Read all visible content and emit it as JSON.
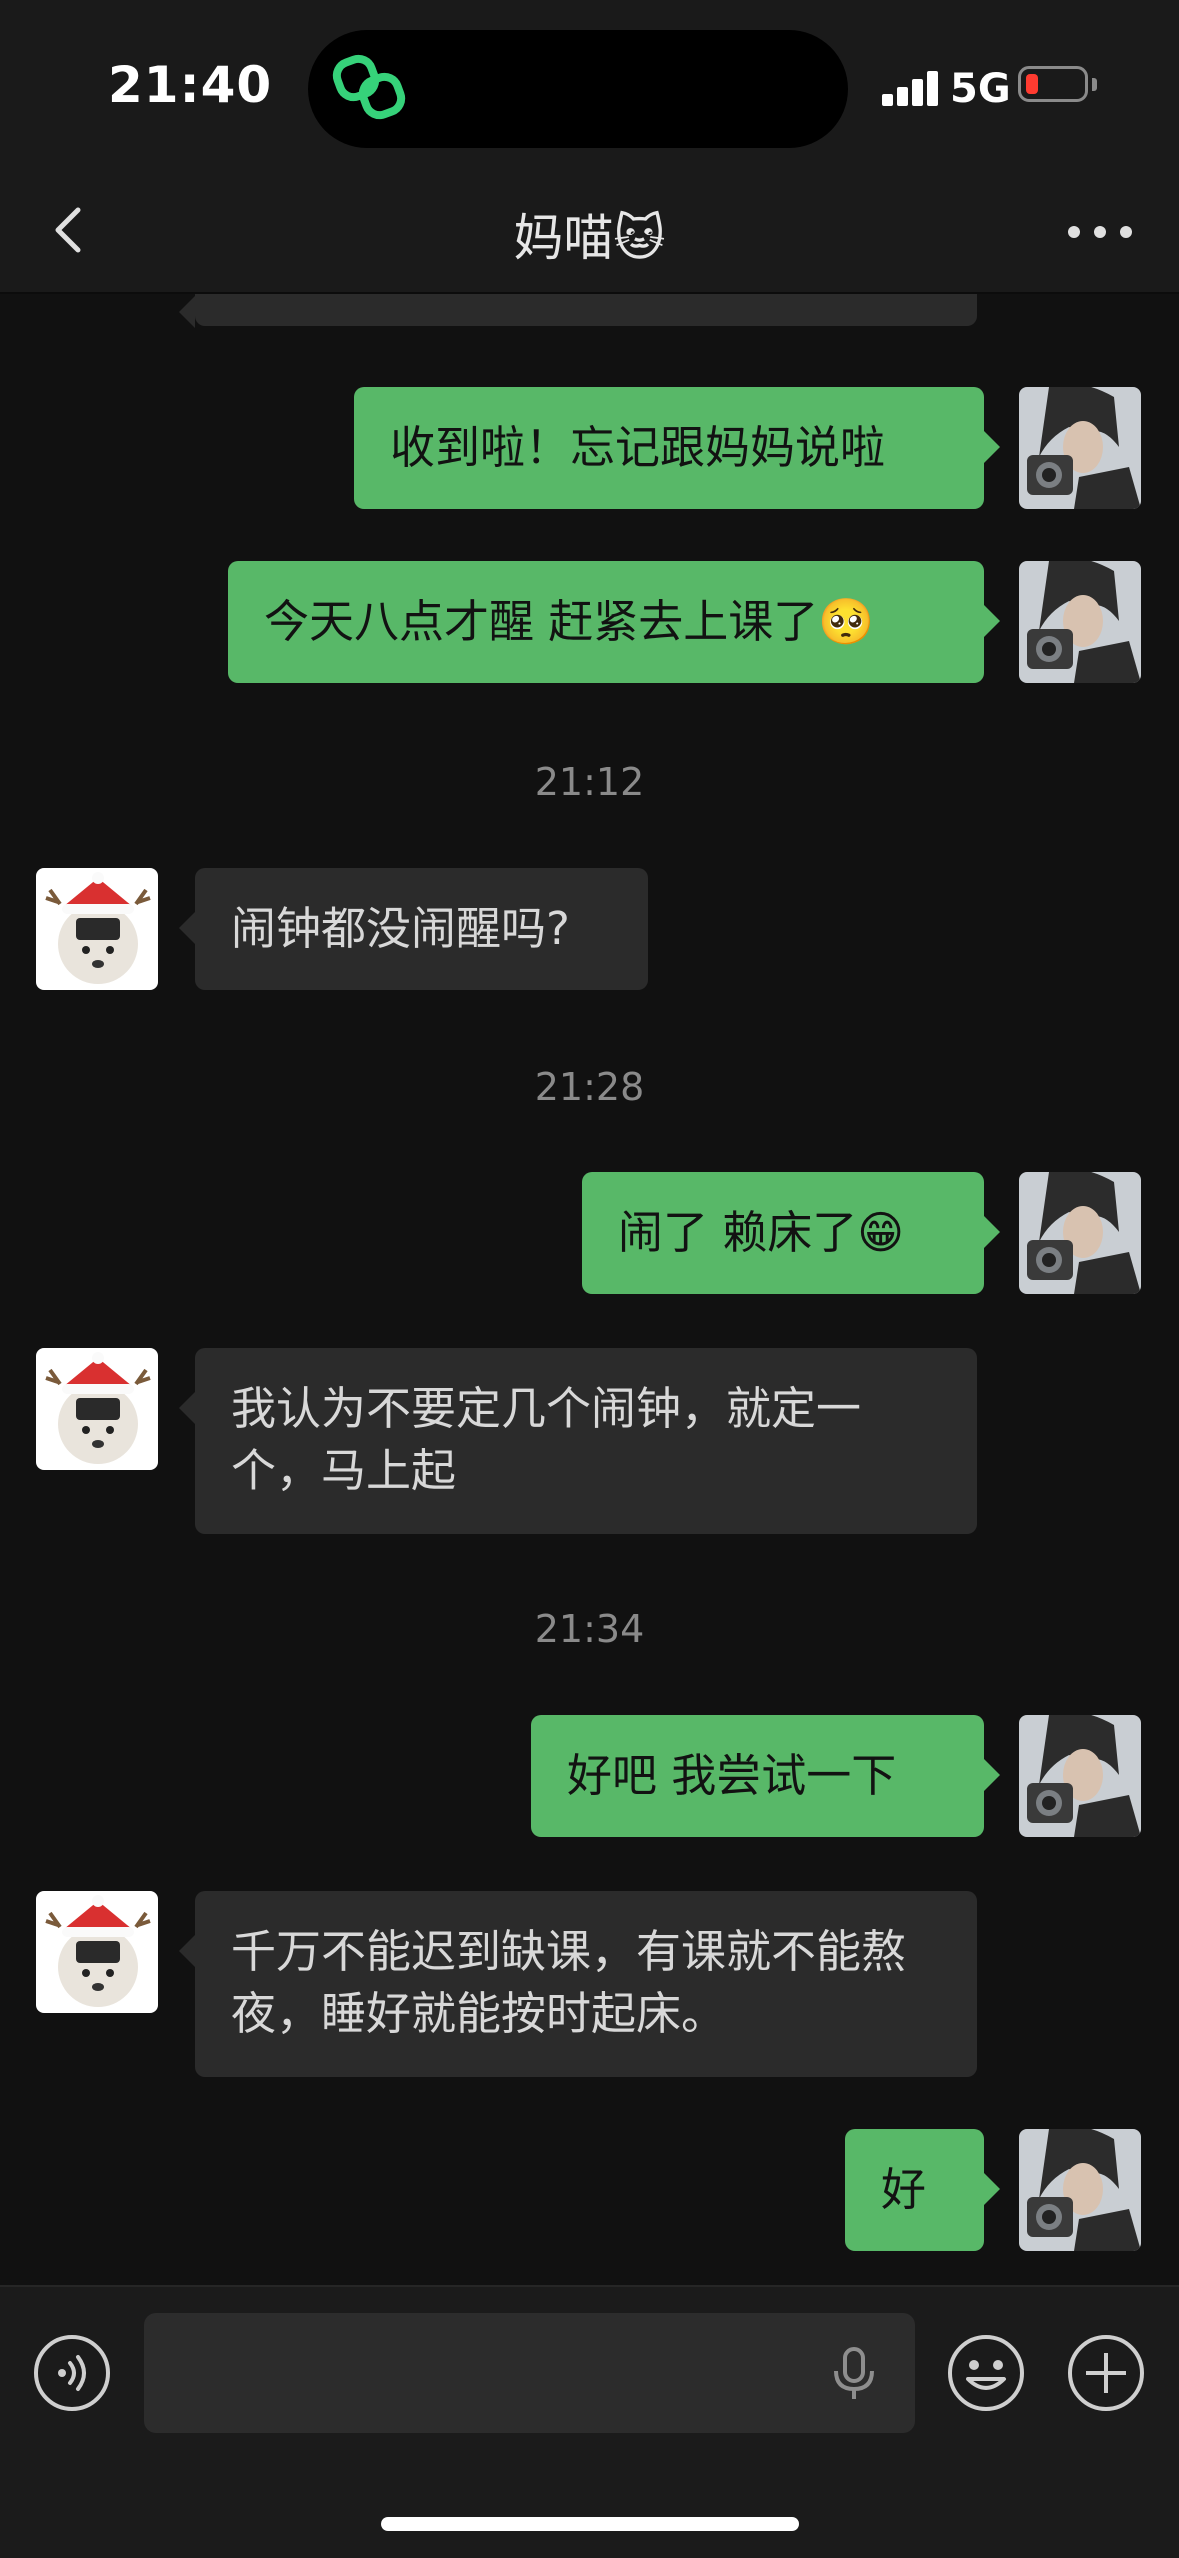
{
  "status_bar": {
    "time": "21:40",
    "network": "5G",
    "battery_level": 0.12,
    "battery_color": "#ff3b30"
  },
  "header": {
    "title": "妈喵🐱",
    "back_icon": "chevron-left-icon",
    "more_icon": "more-dots-icon"
  },
  "colors": {
    "outgoing_bubble": "#58b868",
    "incoming_bubble": "#2b2b2b",
    "background": "#111111"
  },
  "messages": [
    {
      "side": "in",
      "text": ""
    },
    {
      "side": "out",
      "text": "收到啦！忘记跟妈妈说啦"
    },
    {
      "side": "out",
      "text": "今天八点才醒 赶紧去上课了🥺"
    },
    {
      "type": "time",
      "text": "21:12"
    },
    {
      "side": "in",
      "text": "闹钟都没闹醒吗?"
    },
    {
      "type": "time",
      "text": "21:28"
    },
    {
      "side": "out",
      "text": "闹了 赖床了😁"
    },
    {
      "side": "in",
      "text": "我认为不要定几个闹钟，就定一个，马上起"
    },
    {
      "type": "time",
      "text": "21:34"
    },
    {
      "side": "out",
      "text": "好吧 我尝试一下"
    },
    {
      "side": "in",
      "text": "千万不能迟到缺课，有课就不能熬夜，睡好就能按时起床。"
    },
    {
      "side": "out",
      "text": "好"
    }
  ],
  "input_bar": {
    "voice_icon": "voice-mode-icon",
    "mic_icon": "microphone-icon",
    "emoji_icon": "emoji-icon",
    "plus_icon": "plus-icon",
    "value": ""
  }
}
